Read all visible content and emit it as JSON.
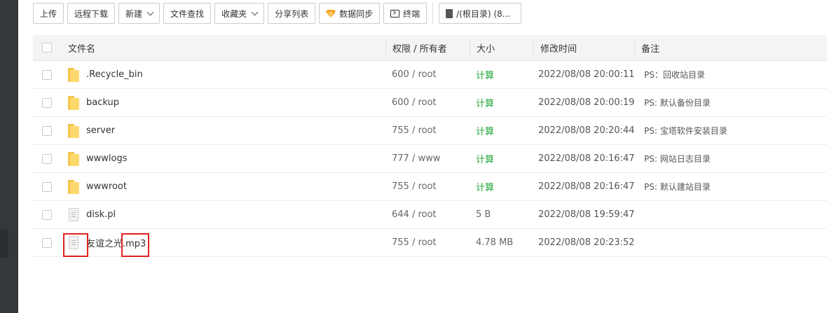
{
  "toolbar": {
    "upload": "上传",
    "remote_download": "远程下载",
    "new": "新建",
    "file_search": "文件查找",
    "favorites": "收藏夹",
    "share_list": "分享列表",
    "data_sync": "数据同步",
    "terminal": "终端",
    "path": "/(根目录) (8..."
  },
  "table": {
    "headers": {
      "name": "文件名",
      "perm": "权限 / 所有者",
      "size": "大小",
      "mtime": "修改时间",
      "note": "备注"
    },
    "rows": [
      {
        "type": "folder",
        "name": ".Recycle_bin",
        "perm": "600 / root",
        "size": "计算",
        "mtime": "2022/08/08 20:00:11",
        "note": "PS：回收站目录"
      },
      {
        "type": "folder",
        "name": "backup",
        "perm": "600 / root",
        "size": "计算",
        "mtime": "2022/08/08 20:00:19",
        "note": "PS: 默认备份目录"
      },
      {
        "type": "folder",
        "name": "server",
        "perm": "755 / root",
        "size": "计算",
        "mtime": "2022/08/08 20:20:44",
        "note": "PS: 宝塔软件安装目录"
      },
      {
        "type": "folder",
        "name": "wwwlogs",
        "perm": "777 / www",
        "size": "计算",
        "mtime": "2022/08/08 20:16:47",
        "note": "PS: 网站日志目录"
      },
      {
        "type": "folder",
        "name": "wwwroot",
        "perm": "755 / root",
        "size": "计算",
        "mtime": "2022/08/08 20:16:47",
        "note": "PS: 默认建站目录"
      },
      {
        "type": "file",
        "name": "disk.pl",
        "perm": "644 / root",
        "size": "5 B",
        "mtime": "2022/08/08 19:59:47",
        "note": ""
      },
      {
        "type": "file",
        "name": "友谊之光.mp3",
        "perm": "755 / root",
        "size": "4.78 MB",
        "mtime": "2022/08/08 20:23:52",
        "note": ""
      }
    ]
  },
  "colors": {
    "calc_green": "#20a53a",
    "highlight_red": "#e02020",
    "folder_yellow": "#ffd86b"
  }
}
